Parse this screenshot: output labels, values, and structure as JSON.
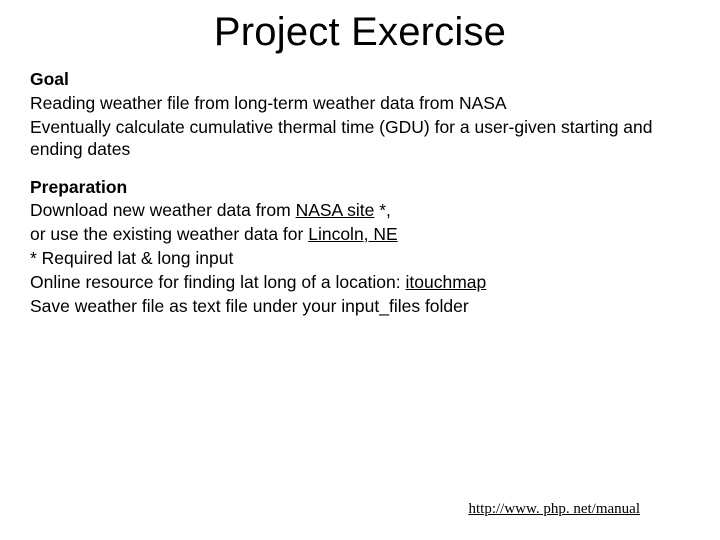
{
  "title": "Project Exercise",
  "section1": {
    "heading": "Goal",
    "line1": "Reading weather file from long-term weather data from NASA",
    "line2": "Eventually calculate cumulative thermal time (GDU) for a user-given starting and ending dates"
  },
  "section2": {
    "heading": "Preparation",
    "line1a": "Download new weather data from ",
    "link1": "NASA site",
    "line1b": " *,",
    "line2a": "or use the existing weather data for ",
    "link2": "Lincoln, NE",
    "indent1": "* Required lat & long input",
    "indent2a": "Online resource for finding lat long of a location: ",
    "link3": "itouchmap",
    "line3": "Save weather file as text file under your input_files folder"
  },
  "footer_link": "http://www. php. net/manual"
}
